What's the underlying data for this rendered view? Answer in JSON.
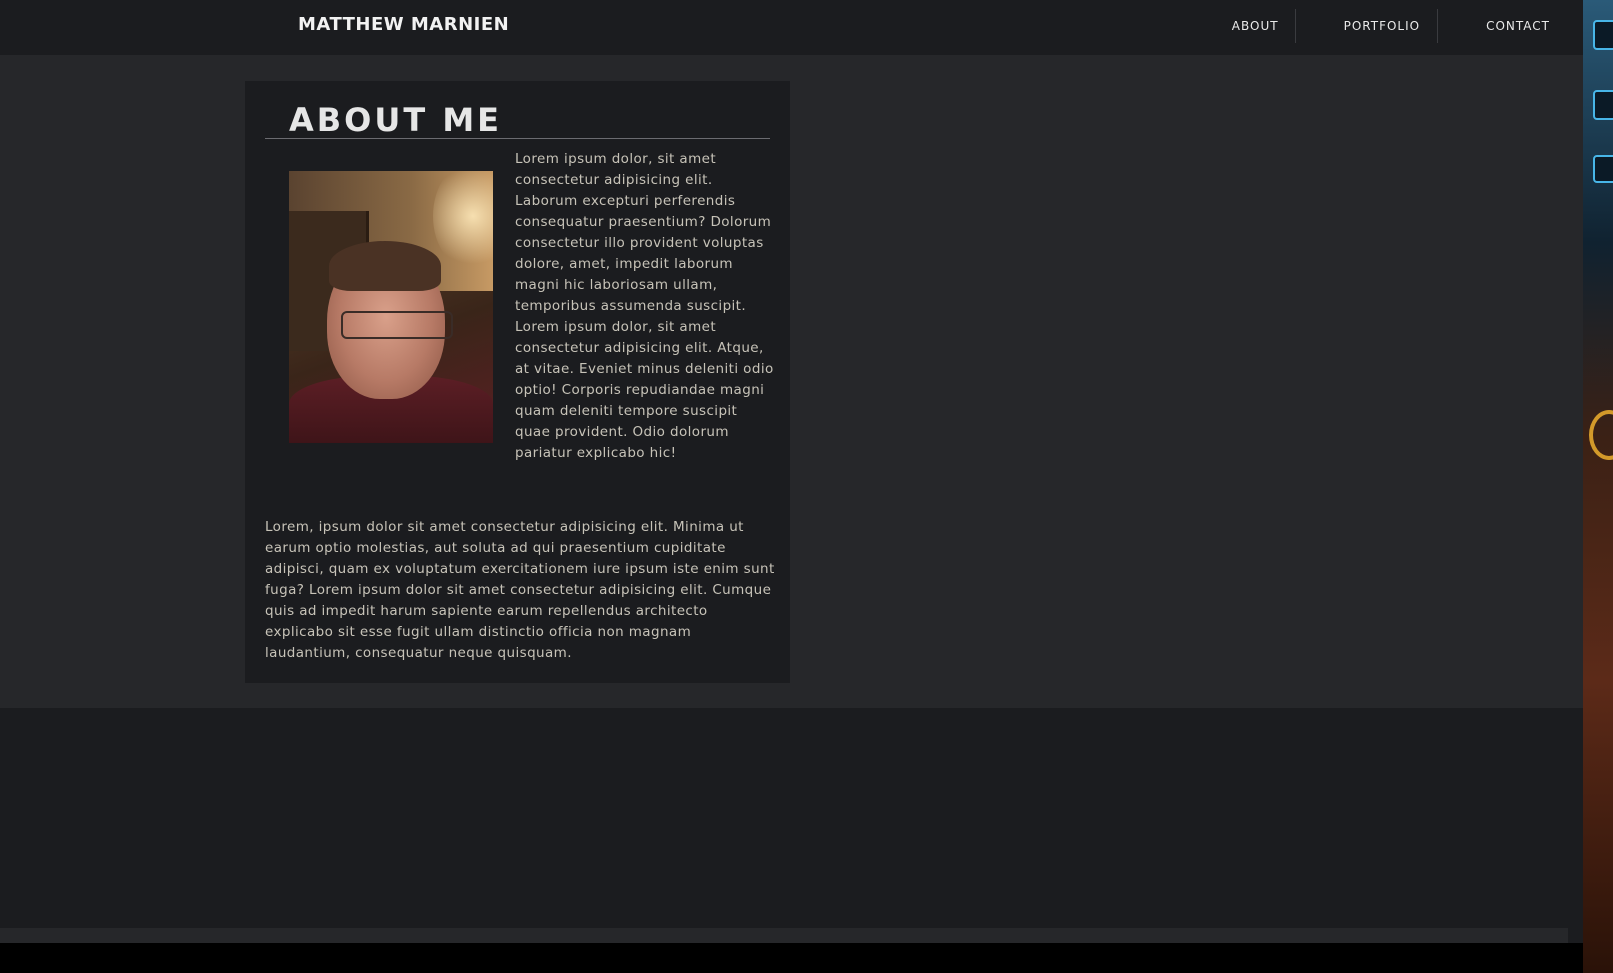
{
  "brand": "MATTHEW MARNIEN",
  "nav": {
    "items": [
      {
        "label": "ABOUT"
      },
      {
        "label": "PORTFOLIO"
      },
      {
        "label": "CONTACT"
      }
    ]
  },
  "about": {
    "title": "ABOUT ME",
    "bio_side": "Lorem ipsum dolor, sit amet consectetur adipisicing elit. Laborum excepturi perferendis consequatur praesentium? Dolorum consectetur illo provident voluptas dolore, amet, impedit laborum magni hic laboriosam ullam, temporibus assumenda suscipit. Lorem ipsum dolor, sit amet consectetur adipisicing elit. Atque, at vitae. Eveniet minus deleniti odio optio! Corporis repudiandae magni quam deleniti tempore suscipit quae provident. Odio dolorum pariatur explicabo hic!",
    "bio_full": "Lorem, ipsum dolor sit amet consectetur adipisicing elit. Minima ut earum optio molestias, aut soluta ad qui praesentium cupiditate adipisci, quam ex voluptatum exercitationem iure ipsum iste enim sunt fuga? Lorem ipsum dolor sit amet consectetur adipisicing elit. Cumque quis ad impedit harum sapiente earum repellendus architecto explicabo sit esse fugit ullam distinctio officia non magnam laudantium, consequatur neque quisquam.",
    "photo_icon": "profile-photo"
  },
  "colors": {
    "background": "#1b1c1f",
    "section": "#26272a",
    "text": "#c7c3b8",
    "heading": "#e6e6e6"
  }
}
